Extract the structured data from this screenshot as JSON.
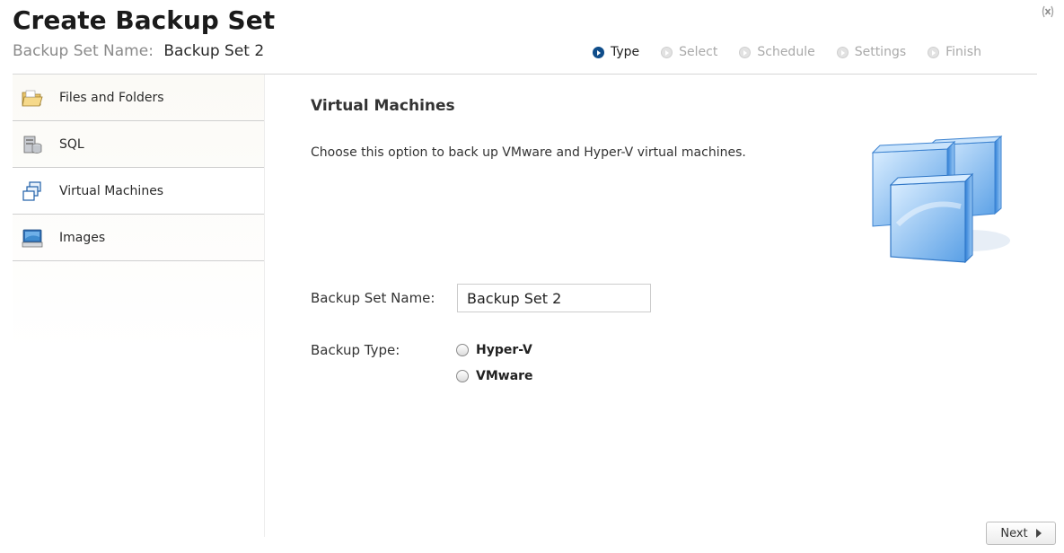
{
  "header": {
    "title": "Create Backup Set",
    "subtitle_label": "Backup Set Name:",
    "subtitle_value": "Backup Set 2"
  },
  "steps": [
    {
      "label": "Type",
      "active": true
    },
    {
      "label": "Select",
      "active": false
    },
    {
      "label": "Schedule",
      "active": false
    },
    {
      "label": "Settings",
      "active": false
    },
    {
      "label": "Finish",
      "active": false
    }
  ],
  "sidebar": {
    "items": [
      {
        "label": "Files and Folders",
        "icon": "folder-icon"
      },
      {
        "label": "SQL",
        "icon": "database-server-icon"
      },
      {
        "label": "Virtual Machines",
        "icon": "virtual-machines-icon",
        "selected": true
      },
      {
        "label": "Images",
        "icon": "disk-image-icon"
      }
    ]
  },
  "main": {
    "section_title": "Virtual Machines",
    "description": "Choose this option to back up VMware and Hyper-V virtual machines.",
    "name_label": "Backup Set Name:",
    "name_value": "Backup Set 2",
    "type_label": "Backup Type:",
    "options": [
      "Hyper-V",
      "VMware"
    ]
  },
  "footer": {
    "next_label": "Next"
  },
  "colors": {
    "active_step": "#0f4d8a",
    "divider": "#cfcfcf"
  }
}
